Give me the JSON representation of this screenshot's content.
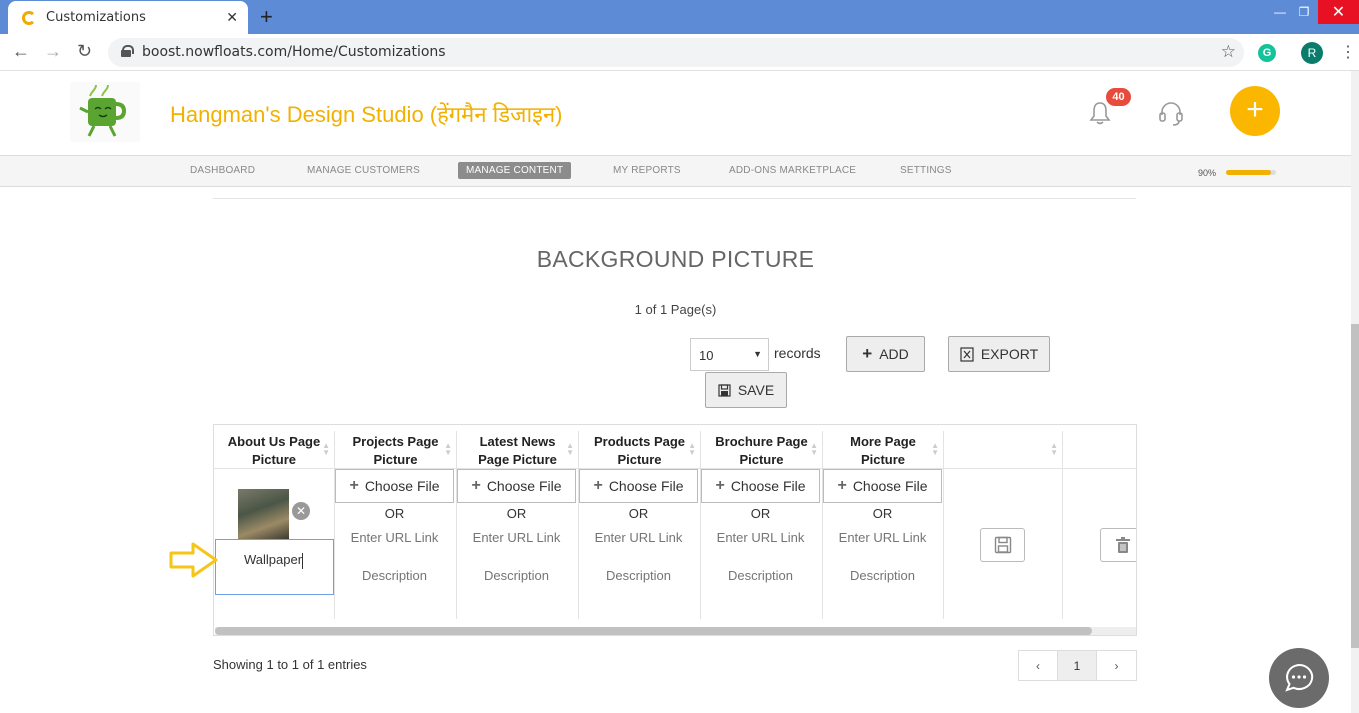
{
  "browser": {
    "tab_title": "Customizations",
    "url": "boost.nowfloats.com/Home/Customizations",
    "profile_initial": "R",
    "extension_letter": "G"
  },
  "header": {
    "brand": "Hangman's Design Studio (हेंगमैन डिजाइन)",
    "notification_count": "40"
  },
  "menu": {
    "items": [
      "DASHBOARD",
      "MANAGE CUSTOMERS",
      "MANAGE CONTENT",
      "MY REPORTS",
      "ADD-ONS MARKETPLACE",
      "SETTINGS"
    ],
    "active": "MANAGE CONTENT",
    "progress_label": "90%",
    "progress_value": 0.9
  },
  "section": {
    "title": "BACKGROUND PICTURE",
    "page_count": "1 of 1 Page(s)"
  },
  "controls": {
    "records_value": "10",
    "records_label": "records",
    "add_label": "ADD",
    "export_label": "EXPORT",
    "save_label": "SAVE"
  },
  "table": {
    "headers": [
      [
        "About Us Page",
        "Picture"
      ],
      [
        "Projects Page",
        "Picture"
      ],
      [
        "Latest News",
        "Page Picture"
      ],
      [
        "Products Page",
        "Picture"
      ],
      [
        "Brochure Page",
        "Picture"
      ],
      [
        "More Page",
        "Picture"
      ]
    ],
    "choose_file_label": "Choose File",
    "or_label": "OR",
    "url_placeholder": "Enter URL Link",
    "description_placeholder": "Description",
    "first_description_value": "Wallpaper"
  },
  "footer": {
    "showing": "Showing 1 to 1 of 1 entries",
    "prev": "‹",
    "current_page": "1",
    "next": "›"
  },
  "colors": {
    "brand": "#f2b100",
    "accent_fab": "#fbb700",
    "badge": "#e84b3c",
    "titlebar": "#5e8bd6"
  }
}
